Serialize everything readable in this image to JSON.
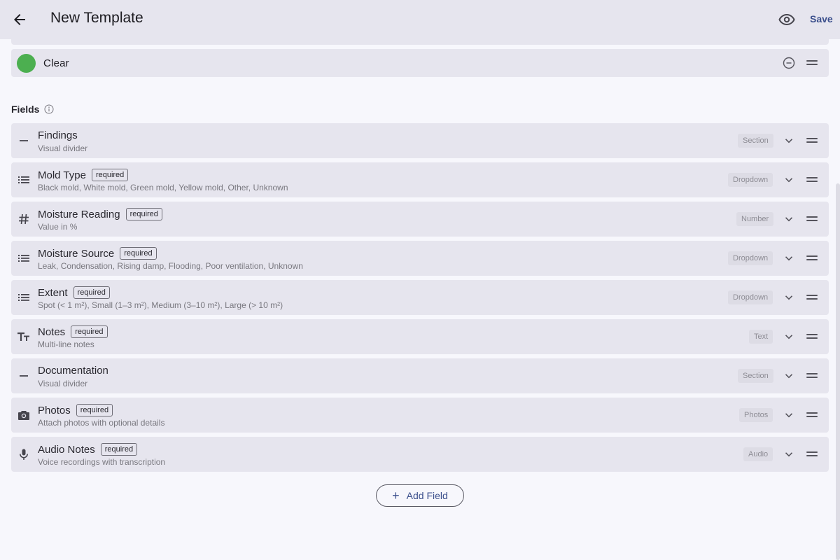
{
  "header": {
    "title": "New Template",
    "save_label": "Save"
  },
  "status": {
    "label": "Clear",
    "color": "#4caf50"
  },
  "fields_section": {
    "label": "Fields"
  },
  "fields": [
    {
      "icon": "section-divider-icon",
      "title": "Findings",
      "required": false,
      "subtitle": "Visual divider",
      "type": "Section"
    },
    {
      "icon": "list-icon",
      "title": "Mold Type",
      "required": true,
      "subtitle": "Black mold, White mold, Green mold, Yellow mold, Other, Unknown",
      "type": "Dropdown"
    },
    {
      "icon": "hash-icon",
      "title": "Moisture Reading",
      "required": true,
      "subtitle": "Value in %",
      "type": "Number"
    },
    {
      "icon": "list-icon",
      "title": "Moisture Source",
      "required": true,
      "subtitle": "Leak, Condensation, Rising damp, Flooding, Poor ventilation, Unknown",
      "type": "Dropdown"
    },
    {
      "icon": "list-icon",
      "title": "Extent",
      "required": true,
      "subtitle": "Spot (< 1 m²), Small (1–3 m²), Medium (3–10 m²), Large (> 10 m²)",
      "type": "Dropdown"
    },
    {
      "icon": "text-icon",
      "title": "Notes",
      "required": true,
      "subtitle": "Multi-line notes",
      "type": "Text"
    },
    {
      "icon": "section-divider-icon",
      "title": "Documentation",
      "required": false,
      "subtitle": "Visual divider",
      "type": "Section"
    },
    {
      "icon": "camera-icon",
      "title": "Photos",
      "required": true,
      "subtitle": "Attach photos with optional details",
      "type": "Photos"
    },
    {
      "icon": "microphone-icon",
      "title": "Audio Notes",
      "required": true,
      "subtitle": "Voice recordings with transcription",
      "type": "Audio"
    }
  ],
  "required_label": "required",
  "add_field_label": "Add Field",
  "colors": {
    "accent": "#3b4f8c",
    "card": "#e6e5ee",
    "background": "#f7f7fc"
  }
}
